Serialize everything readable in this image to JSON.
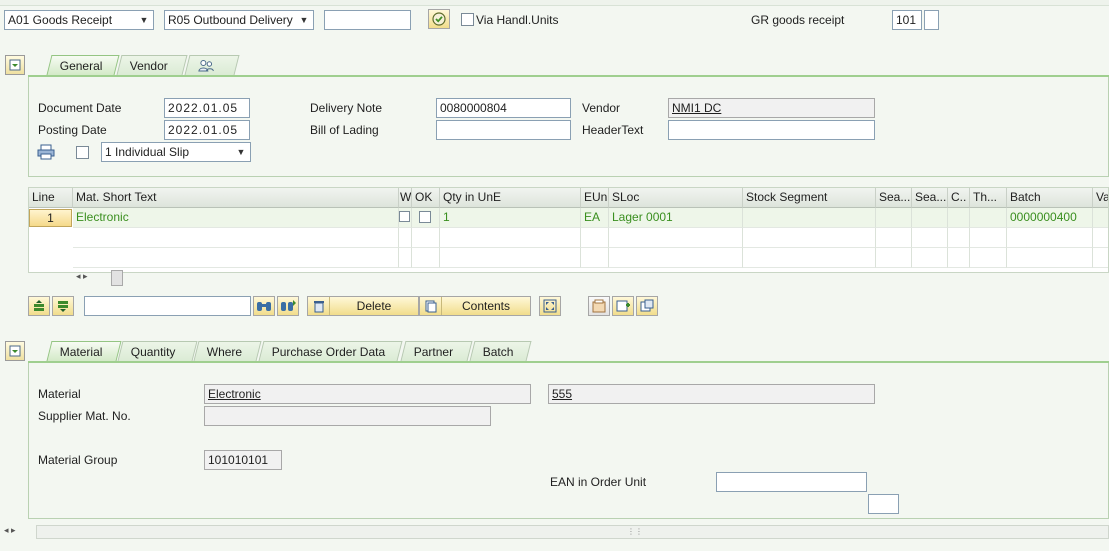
{
  "toolbar": {
    "action_combo": "A01 Goods Receipt",
    "reference_combo": "R05 Outbound Delivery",
    "reference_input": "",
    "via_handling_units": "Via Handl.Units",
    "gr_label": "GR goods receipt",
    "movement_type": "101",
    "movement_extra": ""
  },
  "header_tabs": {
    "general": "General",
    "vendor": "Vendor"
  },
  "header_fields": {
    "document_date_label": "Document Date",
    "document_date": "2022.01.05",
    "posting_date_label": "Posting Date",
    "posting_date": "2022.01.05",
    "slip_combo": "1 Individual Slip",
    "delivery_note_label": "Delivery Note",
    "delivery_note": "0080000804",
    "bill_of_lading_label": "Bill of Lading",
    "bill_of_lading": "",
    "vendor_label": "Vendor",
    "vendor_value": "NMI1 DC",
    "header_text_label": "HeaderText",
    "header_text": ""
  },
  "items_table": {
    "columns": [
      "Line",
      "Mat. Short Text",
      "W",
      "OK",
      "Qty in UnE",
      "EUn",
      "SLoc",
      "Stock Segment",
      "Sea...",
      "Sea...",
      "C..",
      "Th...",
      "Batch",
      "Va"
    ],
    "rows": [
      {
        "line": "1",
        "text": "Electronic",
        "qty": "1",
        "eun": "EA",
        "sloc": "Lager 0001",
        "batch": "0000000400"
      }
    ]
  },
  "item_toolbar": {
    "search_input": "",
    "delete_label": "Delete",
    "contents_label": "Contents"
  },
  "detail_tabs": {
    "material": "Material",
    "quantity": "Quantity",
    "where": "Where",
    "purchase_order_data": "Purchase Order Data",
    "partner": "Partner",
    "batch": "Batch"
  },
  "detail_fields": {
    "material_label": "Material",
    "material_value": "Electronic",
    "material_number": "555",
    "supplier_mat_label": "Supplier Mat. No.",
    "supplier_mat_value": "",
    "material_group_label": "Material Group",
    "material_group_value": "101010101",
    "ean_label": "EAN in Order Unit",
    "ean_value": "",
    "ean_extra": ""
  },
  "colors": {
    "tab_accent": "#9fcf8f",
    "row_text": "#3a8f1f",
    "button_gold": "#f1dd8c"
  }
}
